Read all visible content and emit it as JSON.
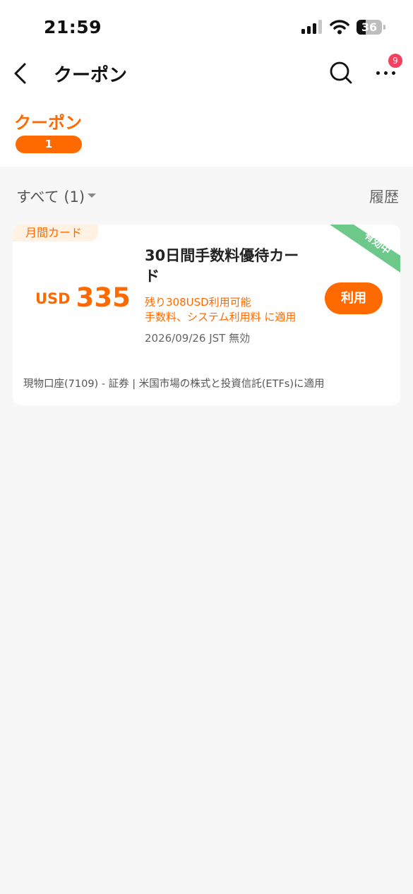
{
  "status_bar": {
    "time": "21:59",
    "battery_level": "36",
    "icons": [
      "signal-icon",
      "wifi-icon",
      "battery-icon"
    ]
  },
  "nav": {
    "title": "クーポン",
    "notification_count": "9",
    "icons": [
      "chevron-left-icon",
      "search-icon",
      "more-icon"
    ]
  },
  "tab": {
    "label": "クーポン",
    "count": "1"
  },
  "filter": {
    "label": "すべて (1)",
    "history_label": "履歴",
    "icons": [
      "caret-down-icon"
    ]
  },
  "coupon": {
    "tag": "月間カード",
    "status": "有効中",
    "currency": "USD",
    "amount": "335",
    "title": "30日間手数料優待カード",
    "remaining": "残り308USD利用可能",
    "scope": "手数料、システム利用料 に適用",
    "expiry": "2026/09/26 JST 無効",
    "action_label": "利用",
    "footer": "現物口座(7109) - 証券 | 米国市場の株式と投資信託(ETFs)に適用",
    "colors": {
      "accent": "#ff6a00",
      "status_ribbon": "#6cc98a",
      "tag_background": "#fff2e3"
    }
  },
  "colors": {
    "notification_badge": "#f43f5e",
    "page_background": "#f7f7f7"
  }
}
